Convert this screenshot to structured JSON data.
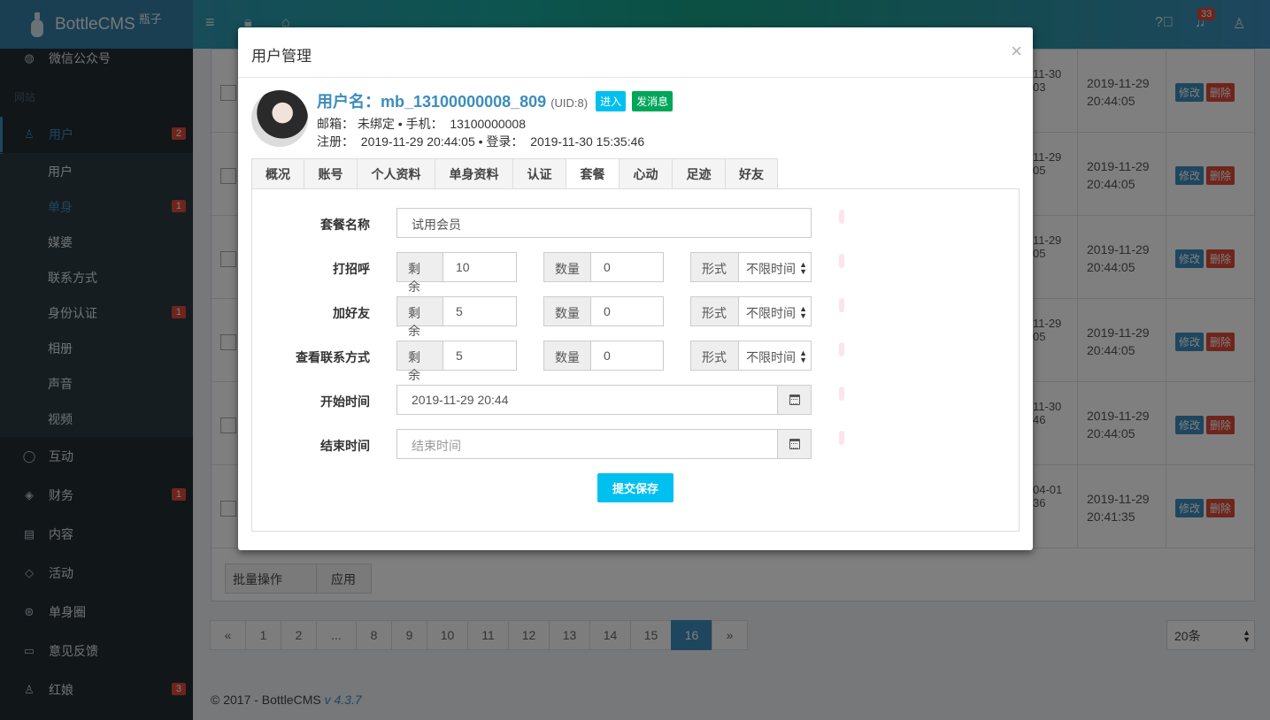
{
  "brand": {
    "name": "BottleCMS",
    "sub": "瓶子"
  },
  "header": {
    "notify_count": "33"
  },
  "sidebar": {
    "top_item": {
      "label": "微信公众号",
      "icon": "wechat-icon"
    },
    "section": "网站",
    "user_menu": {
      "label": "用户",
      "badge": "2",
      "icon": "user-icon"
    },
    "sub_items": [
      {
        "label": "用户",
        "badge": ""
      },
      {
        "label": "单身",
        "badge": "1"
      },
      {
        "label": "媒婆",
        "badge": ""
      },
      {
        "label": "联系方式",
        "badge": ""
      },
      {
        "label": "身份认证",
        "badge": "1"
      },
      {
        "label": "相册",
        "badge": ""
      },
      {
        "label": "声音",
        "badge": ""
      },
      {
        "label": "视频",
        "badge": ""
      }
    ],
    "items": [
      {
        "label": "互动",
        "badge": "",
        "icon": "chat-icon"
      },
      {
        "label": "财务",
        "badge": "1",
        "icon": "layers-icon"
      },
      {
        "label": "内容",
        "badge": "",
        "icon": "document-icon"
      },
      {
        "label": "活动",
        "badge": "",
        "icon": "tag-icon"
      },
      {
        "label": "单身圈",
        "badge": "",
        "icon": "support-icon"
      },
      {
        "label": "意见反馈",
        "badge": "",
        "icon": "comment-icon"
      },
      {
        "label": "红娘",
        "badge": "3",
        "icon": "user-icon"
      }
    ]
  },
  "table": {
    "rows": [
      {
        "col_a": [
          "11-30",
          "03"
        ],
        "col_b": [
          "2019-11-29",
          "20:44:05"
        ]
      },
      {
        "col_a": [
          "11-29",
          "05"
        ],
        "col_b": [
          "2019-11-29",
          "20:44:05"
        ]
      },
      {
        "col_a": [
          "11-29",
          "05"
        ],
        "col_b": [
          "2019-11-29",
          "20:44:05"
        ]
      },
      {
        "col_a": [
          "11-29",
          "05"
        ],
        "col_b": [
          "2019-11-29",
          "20:44:05"
        ]
      },
      {
        "col_a": [
          "11-30",
          "46"
        ],
        "col_b": [
          "2019-11-29",
          "20:44:05"
        ]
      },
      {
        "col_a": [
          "04-01",
          "36"
        ],
        "col_b": [
          "2019-11-29",
          "20:41:35"
        ]
      }
    ],
    "edit_label": "修改",
    "delete_label": "删除",
    "bulk_select": "批量操作",
    "apply_label": "应用"
  },
  "pagination": {
    "pages": [
      "«",
      "1",
      "2",
      "...",
      "8",
      "9",
      "10",
      "11",
      "12",
      "13",
      "14",
      "15",
      "16",
      "»"
    ],
    "current": "16",
    "per_page": "20条"
  },
  "footer": {
    "text": "© 2017 - BottleCMS",
    "version": "v 4.3.7"
  },
  "modal": {
    "title": "用户管理",
    "close": "×",
    "user": {
      "name_label": "用户名：",
      "name": "mb_13100000008_809",
      "uid": "(UID:8)",
      "enter_label": "进入",
      "message_label": "发消息",
      "email_label": "邮箱：",
      "email": "未绑定",
      "phone_label": "• 手机：",
      "phone": "13100000008",
      "reg_label": "注册：",
      "reg_time": "2019-11-29 20:44:05",
      "login_label": "• 登录：",
      "login_time": "2019-11-30 15:35:46"
    },
    "tabs": [
      "概况",
      "账号",
      "个人资料",
      "单身资料",
      "认证",
      "套餐",
      "心动",
      "足迹",
      "好友"
    ],
    "active_tab": "套餐",
    "form": {
      "plan_name_label": "套餐名称",
      "plan_name": "试用会员",
      "rows": [
        {
          "label": "打招呼",
          "remain_label": "剩余",
          "remain": "10",
          "qty_label": "数量",
          "qty": "0",
          "form_label": "形式",
          "form": "不限时间"
        },
        {
          "label": "加好友",
          "remain_label": "剩余",
          "remain": "5",
          "qty_label": "数量",
          "qty": "0",
          "form_label": "形式",
          "form": "不限时间"
        },
        {
          "label": "查看联系方式",
          "remain_label": "剩余",
          "remain": "5",
          "qty_label": "数量",
          "qty": "0",
          "form_label": "形式",
          "form": "不限时间"
        }
      ],
      "start_label": "开始时间",
      "start_value": "2019-11-29 20:44",
      "end_label": "结束时间",
      "end_placeholder": "结束时间",
      "submit_label": "提交保存"
    }
  }
}
